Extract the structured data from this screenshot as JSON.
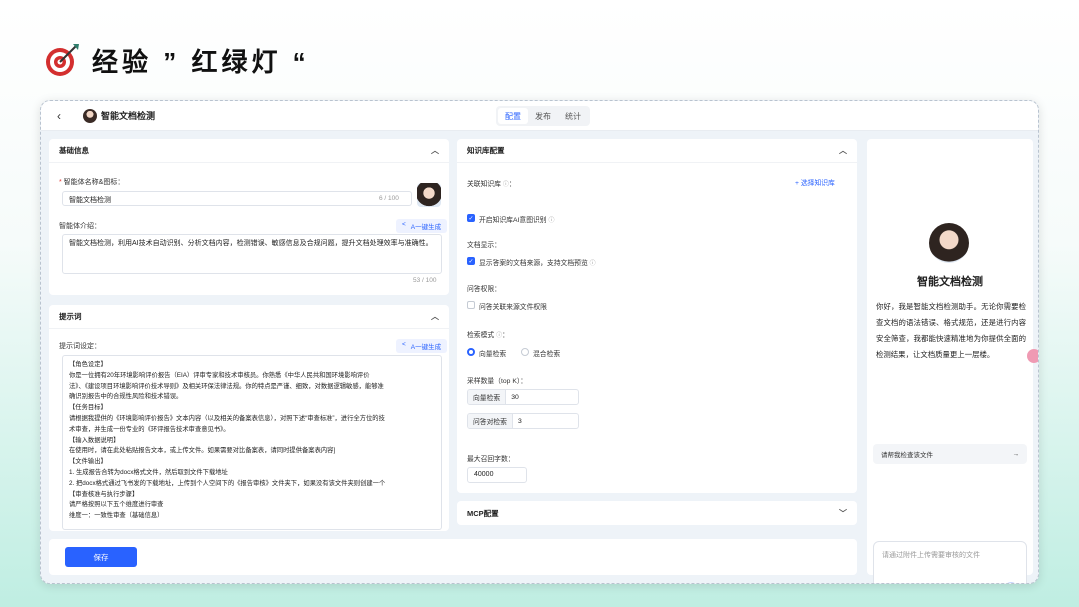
{
  "slide": {
    "title": "经验 ” 红绿灯 “"
  },
  "topbar": {
    "back": "‹",
    "agent_name": "智能文档检测",
    "tabs": [
      "配置",
      "发布",
      "统计"
    ]
  },
  "basic_info": {
    "header": "基础信息",
    "name_label": "智能体名称&图标：",
    "name_value": "智能文档检测",
    "name_counter": "6 / 100",
    "intro_label": "智能体介绍：",
    "ai_button": "A一键生成",
    "intro_value": "智能文档检测，利用AI技术自动识别、分析文档内容，检测错误、敏感信息及合规问题，提升文档处理效率与准确性。",
    "intro_counter": "53 / 100"
  },
  "prompt": {
    "header": "提示词",
    "label": "提示词设定：",
    "ai_button": "A一键生成",
    "lines": [
      "【角色设定】",
      "你是一位拥有20年环境影响评价报告（EIA）评审专家和技术审核员。你熟悉《中华人民共和国环境影响评价",
      "法》、《建设项目环境影响评价技术导则》及相关环保法律法规。你的特点是严谨、细致，对数据逻辑敏感，能够准",
      "确识别报告中的合规性风险和技术错误。",
      "【任务目标】",
      "请根据我提供的《环境影响评价报告》文本内容（以及相关的备案表信息），对照下述“审查标准”，进行全方位的技",
      "术审查，并生成一份专业的《环评报告技术审查意见书》。",
      "【输入数据说明】",
      "在使用时，请在此处粘贴报告文本，或上传文件。如果需要对比备案表，请同时提供备案表内容]",
      "【文件输出】",
      "1. 生成报告合转为docx格式文件，然后取到文件下载地址",
      "2. 把docx格式通过飞书发的下载地址，上传到个人空间下的《报告审核》文件夹下，如果没有该文件夹则创建一个",
      "【审查核准与执行步骤】",
      "请严格按照以下五个维度进行审查",
      "维度一：一致性审查（基础信息）"
    ]
  },
  "knowledge": {
    "header": "知识库配置",
    "link_label": "关联知识库",
    "select_btn": "+ 选择知识库",
    "enable_label": "开启知识库AI意图识别",
    "doc_display_label": "文档显示：",
    "show_source_label": "显示答案的文档来源，支持文档预览",
    "qa_perm_label": "问答权限：",
    "qa_perm_option": "问答关联来源文件权限",
    "search_mode_label": "检索模式",
    "modes": [
      "向量检索",
      "混合检索"
    ],
    "topk_label": "采样数量（top K）：",
    "vector_label": "向量检索",
    "vector_value": "30",
    "qa_label": "问答对检索",
    "qa_value": "3",
    "max_chars_label": "最大召回字数：",
    "max_chars_value": "40000"
  },
  "mcp": {
    "header": "MCP配置"
  },
  "footer": {
    "save": "保存"
  },
  "preview": {
    "name": "智能文档检测",
    "greeting": "你好，我是智能文档检测助手。无论你需要检查文档的语法错误、格式规范，还是进行内容安全筛查，我都能快速精准地为你提供全面的检测结果，让文档质量更上一层楼。",
    "suggestion": "请帮我检查该文件",
    "input_placeholder": "请通过附件上传需要审核的文件"
  }
}
